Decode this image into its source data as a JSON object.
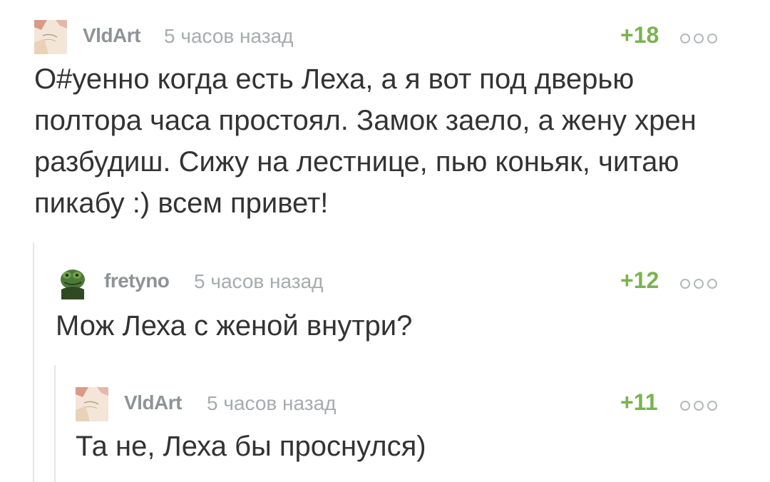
{
  "comments": [
    {
      "username": "VldArt",
      "time": "5 часов назад",
      "rating": "+18",
      "text": [
        "О#уенно когда есть Леха, а я вот под дверью",
        "полтора часа простоял. Замок заело, а жену хрен",
        "разбудиш. Сижу на лестнице, пью коньяк, читаю",
        "пикабу :) всем привет!"
      ]
    },
    {
      "username": "fretyno",
      "time": "5 часов назад",
      "rating": "+12",
      "text": [
        "Мож Леха с женой внутри?"
      ]
    },
    {
      "username": "VldArt",
      "time": "5 часов назад",
      "rating": "+11",
      "text": [
        "Та не, Леха бы проснулся)"
      ]
    }
  ],
  "icons": {
    "more": "more-options-icon",
    "avatar_vldart": "avatar-vldart",
    "avatar_fretyno": "avatar-fretyno"
  },
  "colors": {
    "rating": "#7ab34f",
    "username": "#8e9398",
    "time": "#a7abaf",
    "text": "#333333",
    "thread_line": "#e6e6e6"
  }
}
